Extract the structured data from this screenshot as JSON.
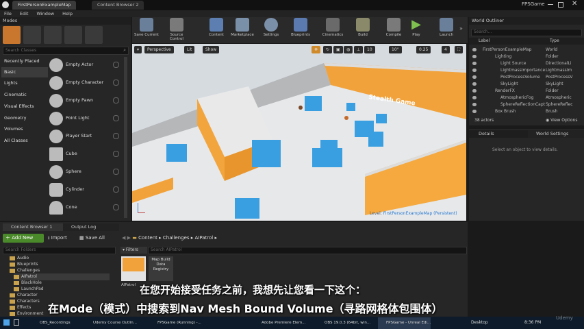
{
  "tabs": [
    "FirstPersonExampleMap",
    "Content Browser 2"
  ],
  "window_title": "FPSGame",
  "menu": [
    "File",
    "Edit",
    "Window",
    "Help"
  ],
  "modes": {
    "title": "Modes",
    "search_placeholder": "Search Classes"
  },
  "categories": [
    "Recently Placed",
    "Basic",
    "Lights",
    "Cinematic",
    "Visual Effects",
    "Geometry",
    "Volumes",
    "All Classes"
  ],
  "place_items": [
    "Empty Actor",
    "Empty Character",
    "Empty Pawn",
    "Point Light",
    "Player Start",
    "Cube",
    "Sphere",
    "Cylinder",
    "Cone"
  ],
  "toolbar": [
    "Save Current",
    "Source Control",
    "Content",
    "Marketplace",
    "Settings",
    "Blueprints",
    "Cinematics",
    "Build",
    "Compile",
    "Play",
    "Launch"
  ],
  "viewport": {
    "perspective": "Perspective",
    "lit": "Lit",
    "show": "Show",
    "grid": "10",
    "angle": "10°",
    "scale": "0.25",
    "cam": "4",
    "wall_text": "Stealth Game",
    "level_label": "Level:",
    "level_name": "FirstPersonExampleMap (Persistent)"
  },
  "outliner": {
    "title": "World Outliner",
    "search_placeholder": "Search...",
    "col_label": "Label",
    "col_type": "Type",
    "rows": [
      {
        "label": "FirstPersonExampleMap",
        "type": "World"
      },
      {
        "label": "Lighting",
        "type": "Folder"
      },
      {
        "label": "Light Source",
        "type": "DirectionalLi"
      },
      {
        "label": "LightmassImportance",
        "type": "LightmassIm"
      },
      {
        "label": "PostProcessVolume",
        "type": "PostProcessV"
      },
      {
        "label": "SkyLight",
        "type": "SkyLight"
      },
      {
        "label": "RenderFX",
        "type": "Folder"
      },
      {
        "label": "AtmosphericFog",
        "type": "Atmospheric"
      },
      {
        "label": "SphereReflectionCapt",
        "type": "SphereReflec"
      },
      {
        "label": "Box Brush",
        "type": "Brush"
      }
    ],
    "count": "38 actors",
    "view_options": "View Options"
  },
  "details": {
    "tab1": "Details",
    "tab2": "World Settings",
    "empty": "Select an object to view details."
  },
  "content_browser": {
    "tab1": "Content Browser 1",
    "tab2": "Output Log",
    "add_new": "Add New",
    "import": "Import",
    "save_all": "Save All",
    "path": [
      "Content",
      "Challenges",
      "AIPatrol"
    ],
    "search_folders": "Search Folders",
    "filters": "Filters",
    "search_assets": "Search AIPatrol",
    "folders": [
      "Audio",
      "Blueprints",
      "Challenges",
      "AIPatrol",
      "BlackHole",
      "LaunchPad",
      "Character",
      "Characters",
      "Effects",
      "Environment"
    ],
    "assets": [
      "AIPatrol",
      "Map Build Data Registry"
    ]
  },
  "subtitles": [
    "在您开始接受任务之前，我想先让您看一下这个：",
    "在Mode（模式）中搜索到Nav Mesh Bound Volume（寻路网格体包围体）"
  ],
  "taskbar": [
    "OBS_Recordings",
    "Udemy Course Outlin...",
    "FPSGame (Running) -...",
    "Adobe Premiere Elem...",
    "OBS 19.0.3 (64bit, win...",
    "FPSGame - Unreal Edi..."
  ],
  "tray": {
    "desktop": "Desktop",
    "time": "8:36 PM"
  },
  "watermark": "Udemy"
}
